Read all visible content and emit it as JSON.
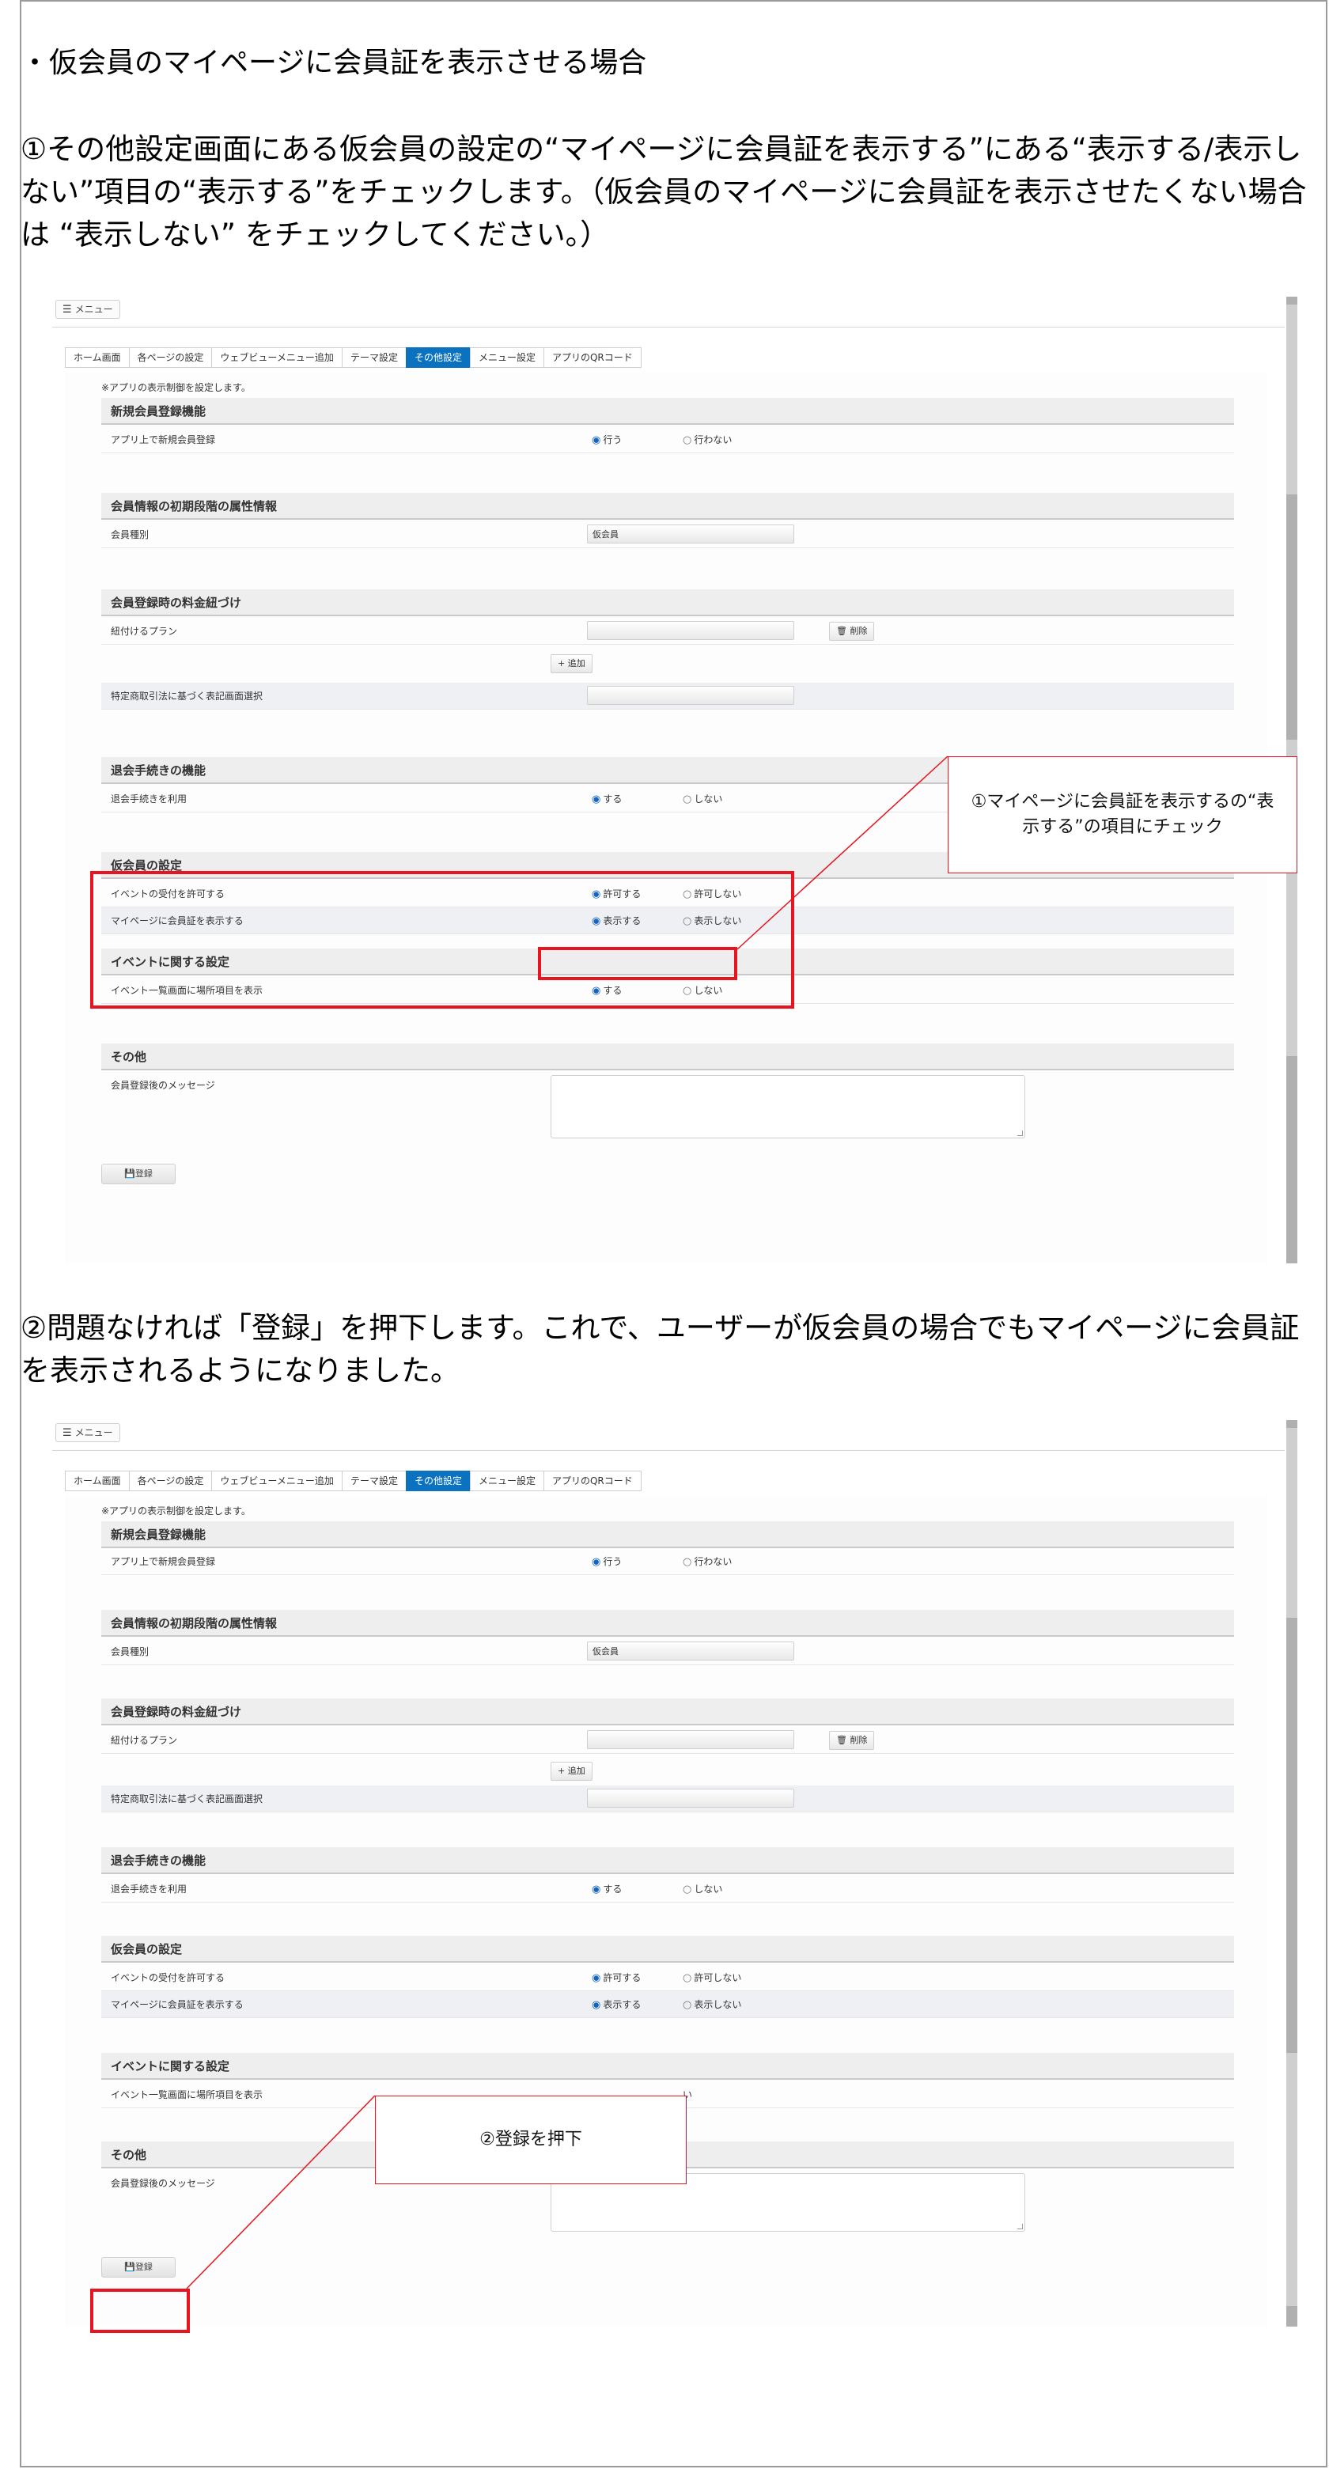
{
  "doc": {
    "heading": "・仮会員のマイページに会員証を表示させる場合",
    "step1_text": "①その他設定画面にある仮会員の設定の“マイページに会員証を表示する”にある“表示する/表示しない”項目の“表示する”をチェックします。（仮会員のマイページに会員証を表示させたくない場合は “表示しない” をチェックしてください。）",
    "step2_text": "②問題なければ「登録」を押下します。これで、ユーザーが仮会員の場合でもマイページに会員証を表示されるようになりました。",
    "callout1": "①マイページに会員証を表示するの“表示する”の項目にチェック",
    "callout2": "②登録を押下"
  },
  "screen": {
    "menu_label": "メニュー",
    "tabs": [
      "ホーム画面",
      "各ページの設定",
      "ウェブビューメニュー追加",
      "テーマ設定",
      "その他設定",
      "メニュー設定",
      "アプリのQRコード"
    ],
    "active_tab": "その他設定",
    "note": "※アプリの表示制御を設定します。",
    "sections": {
      "new_member": {
        "title": "新規会員登録機能",
        "row_label": "アプリ上で新規会員登録",
        "option_on": "行う",
        "option_off": "行わない"
      },
      "initial_attr": {
        "title": "会員情報の初期段階の属性情報",
        "row_label": "会員種別",
        "value": "仮会員"
      },
      "plan": {
        "title": "会員登録時の料金紐づけ",
        "row_label": "紐付けるプラン",
        "delete_label": "削除",
        "add_label": "追加",
        "row2_label": "特定商取引法に基づく表記画面選択"
      },
      "withdraw": {
        "title": "退会手続きの機能",
        "row_label": "退会手続きを利用",
        "option_on": "する",
        "option_off": "しない"
      },
      "provisional": {
        "title": "仮会員の設定",
        "row1_label": "イベントの受付を許可する",
        "row1_on": "許可する",
        "row1_off": "許可しない",
        "row2_label": "マイページに会員証を表示する",
        "row2_on": "表示する",
        "row2_off": "表示しない"
      },
      "event": {
        "title": "イベントに関する設定",
        "row_label": "イベント一覧画面に場所項目を表示",
        "option_on": "する",
        "option_off": "しない",
        "option_off_partial": "い"
      },
      "other": {
        "title": "その他",
        "row_label": "会員登録後のメッセージ"
      }
    },
    "register_label": "登録"
  },
  "colors": {
    "annotation_red": "#e8141f",
    "active_tab_blue": "#0b72c0",
    "radio_blue": "#1565c0"
  }
}
